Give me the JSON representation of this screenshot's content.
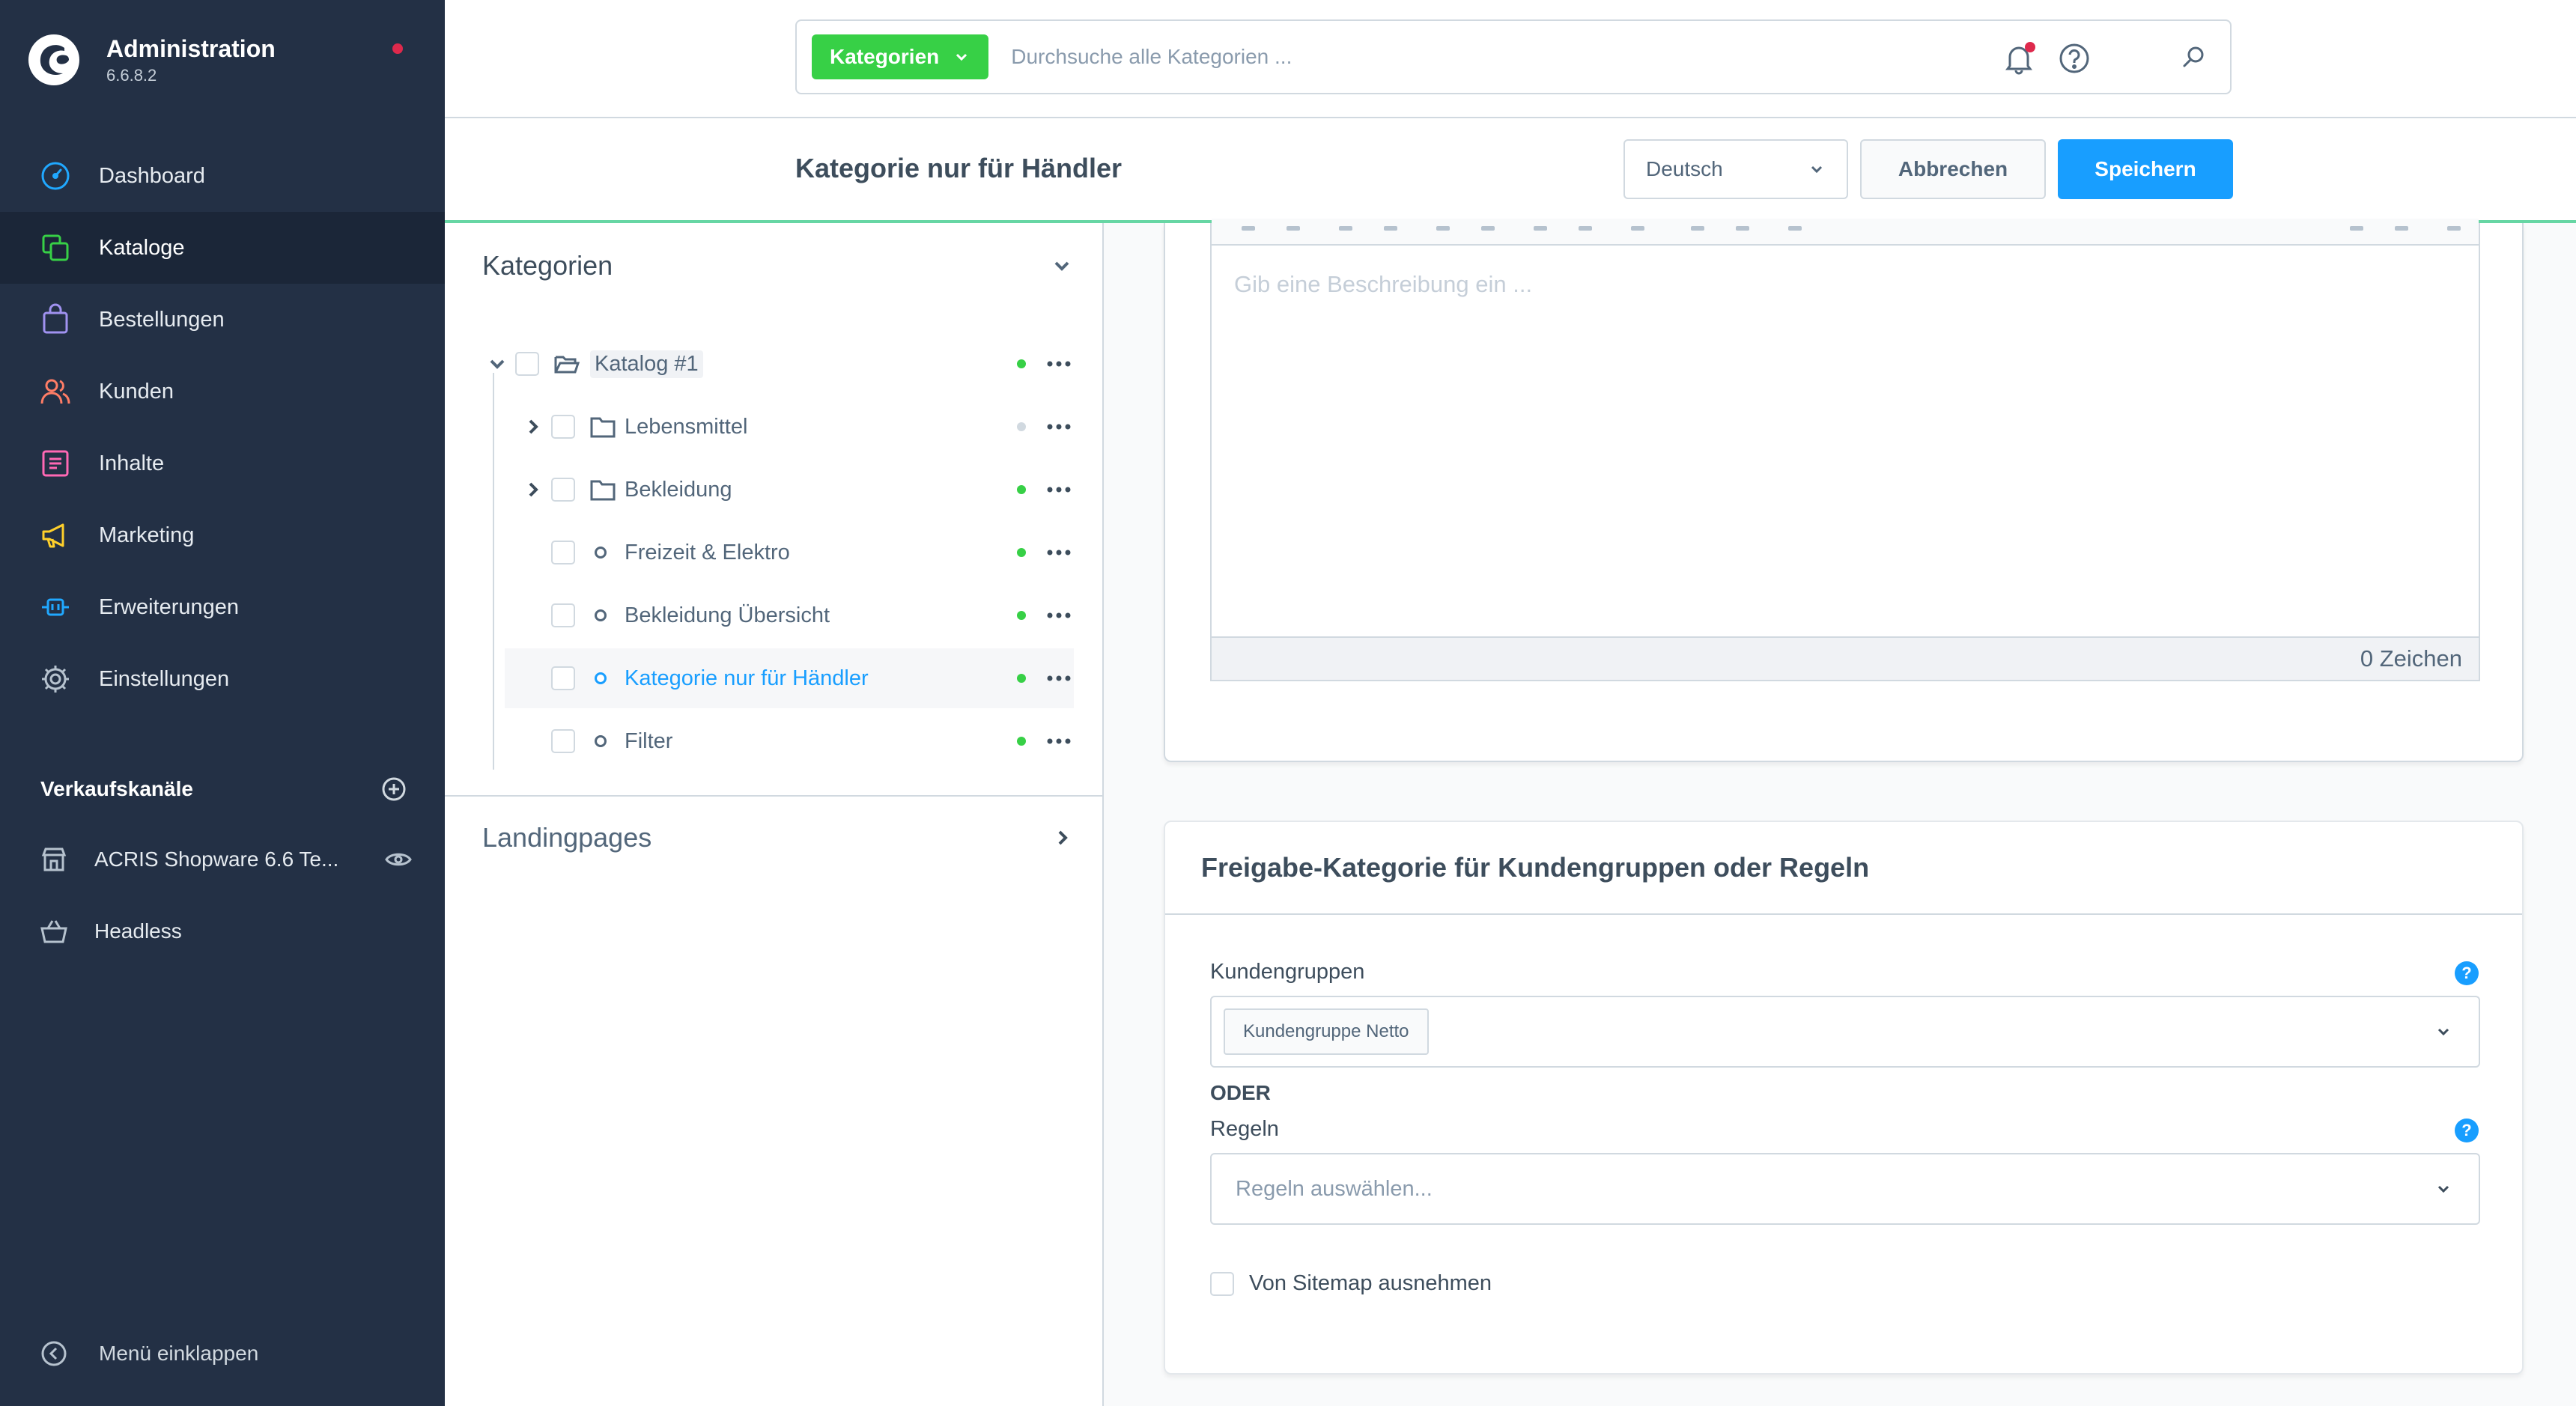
{
  "app": {
    "title": "Administration",
    "version": "6.6.8.2"
  },
  "nav": {
    "dashboard": "Dashboard",
    "kataloge": "Kataloge",
    "bestellungen": "Bestellungen",
    "kunden": "Kunden",
    "inhalte": "Inhalte",
    "marketing": "Marketing",
    "erweiterungen": "Erweiterungen",
    "einstellungen": "Einstellungen"
  },
  "channels": {
    "title": "Verkaufskanäle",
    "items": [
      "ACRIS Shopware 6.6 Te...",
      "Headless"
    ]
  },
  "collapse_label": "Menü einklappen",
  "search": {
    "type_label": "Kategorien",
    "placeholder": "Durchsuche alle Kategorien ..."
  },
  "smartbar": {
    "title": "Kategorie nur für Händler",
    "language": "Deutsch",
    "cancel": "Abbrechen",
    "save": "Speichern"
  },
  "tree": {
    "title": "Kategorien",
    "root": "Katalog #1",
    "items": [
      {
        "label": "Lebensmittel",
        "active": false
      },
      {
        "label": "Bekleidung",
        "active": true
      },
      {
        "label": "Freizeit & Elektro",
        "active": true
      },
      {
        "label": "Bekleidung Übersicht",
        "active": true
      },
      {
        "label": "Kategorie nur für Händler",
        "active": true
      },
      {
        "label": "Filter",
        "active": true
      }
    ],
    "landingpages": "Landingpages"
  },
  "editor": {
    "placeholder": "Gib eine Beschreibung ein ...",
    "char_count": "0 Zeichen"
  },
  "release": {
    "title": "Freigabe-Kategorie für Kundengruppen oder Regeln",
    "customer_groups_label": "Kundengruppen",
    "customer_group_tag": "Kundengruppe Netto",
    "or_label": "ODER",
    "rules_label": "Regeln",
    "rules_placeholder": "Regeln auswählen...",
    "sitemap_label": "Von Sitemap ausnehmen"
  },
  "colors": {
    "sidebar": "#233045",
    "accent": "#189eff",
    "green": "#37d046",
    "notify": "#de294c"
  }
}
